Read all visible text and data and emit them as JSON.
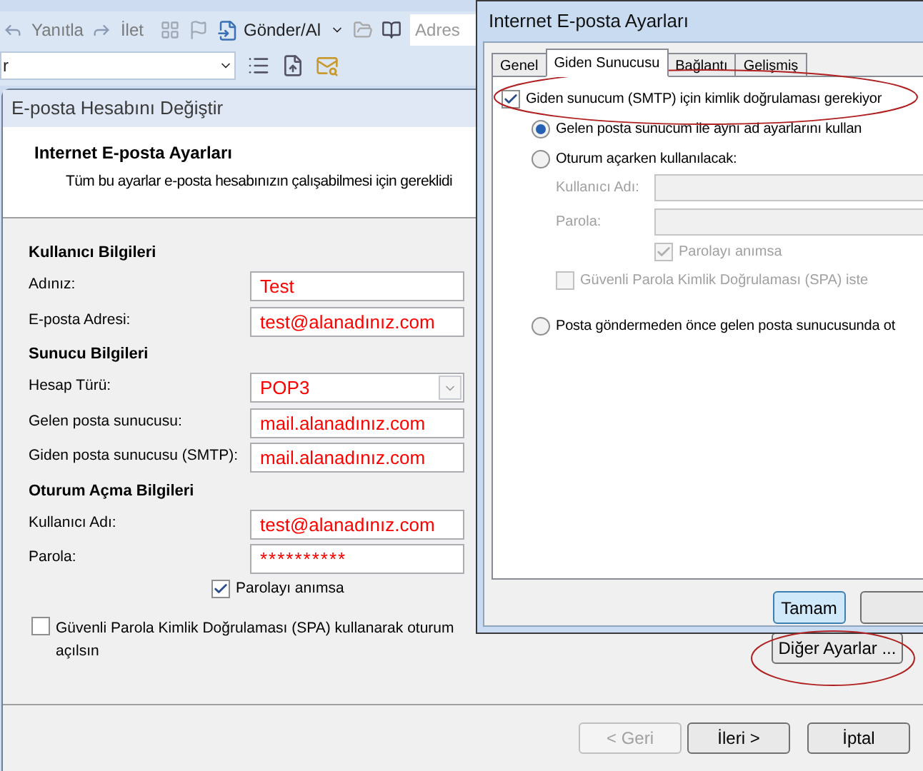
{
  "toolbar": {
    "reply": "Yanıtla",
    "forward": "İlet",
    "send_receive": "Gönder/Al",
    "address_search": "Adres",
    "folder_field": "r"
  },
  "account_window": {
    "title": "E-posta Hesabını Değiştir",
    "heading": "Internet E-posta Ayarları",
    "subtitle": "Tüm bu ayarlar e-posta hesabınızın çalışabilmesi için gereklidi",
    "sections": [
      {
        "title": "Kullanıcı Bilgileri",
        "fields": [
          {
            "kind": "text",
            "label": "Adınız:",
            "value": "Test"
          },
          {
            "kind": "text",
            "label": "E-posta Adresi:",
            "value": "test@alanadınız.com"
          }
        ]
      },
      {
        "title": "Sunucu Bilgileri",
        "fields": [
          {
            "kind": "dropdown",
            "label": "Hesap Türü:",
            "value": "POP3"
          },
          {
            "kind": "text",
            "label": "Gelen posta sunucusu:",
            "value": "mail.alanadınız.com"
          },
          {
            "kind": "text",
            "label": "Giden posta sunucusu (SMTP):",
            "value": "mail.alanadınız.com"
          }
        ]
      },
      {
        "title": "Oturum Açma Bilgileri",
        "fields": [
          {
            "kind": "text",
            "label": "Kullanıcı Adı:",
            "value": "test@alanadınız.com"
          },
          {
            "kind": "password",
            "label": "Parola:",
            "value": "**********"
          }
        ]
      }
    ],
    "remember_password": {
      "label": "Parolayı anımsa",
      "checked": true
    },
    "spa": {
      "label": "Güvenli Parola Kimlik Doğrulaması (SPA) kullanarak oturum açılsın",
      "checked": false
    },
    "more_settings_button": "Diğer Ayarlar ...",
    "buttons": [
      {
        "label": "< Geri",
        "disabled": true
      },
      {
        "label": "İleri >",
        "disabled": false
      },
      {
        "label": "İptal",
        "disabled": false
      }
    ]
  },
  "settings_dialog": {
    "title": "Internet E-posta Ayarları",
    "tabs": [
      {
        "label": "Genel",
        "selected": false
      },
      {
        "label": "Giden Sunucusu",
        "selected": true
      },
      {
        "label": "Bağlantı",
        "selected": false
      },
      {
        "label": "Gelişmiş",
        "selected": false
      }
    ],
    "smtp_auth": {
      "label": "Giden sunucum (SMTP) için kimlik doğrulaması gerekiyor",
      "checked": true
    },
    "auth_methods": [
      {
        "label": "Gelen posta sunucum ile aynı ad ayarlarını kullan",
        "selected": true
      },
      {
        "label": "Oturum açarken kullanılacak:",
        "selected": false
      },
      {
        "label": "Posta göndermeden önce gelen posta sunucusunda ot",
        "selected": false
      }
    ],
    "login_fields": [
      {
        "label": "Kullanıcı Adı:",
        "disabled": true
      },
      {
        "label": "Parola:",
        "disabled": true
      }
    ],
    "remember_password": {
      "label": "Parolayı anımsa",
      "checked": true,
      "disabled": true
    },
    "spa": {
      "label": "Güvenli Parola Kimlik Doğrulaması (SPA) iste",
      "checked": false,
      "disabled": true
    },
    "ok_button": "Tamam"
  }
}
